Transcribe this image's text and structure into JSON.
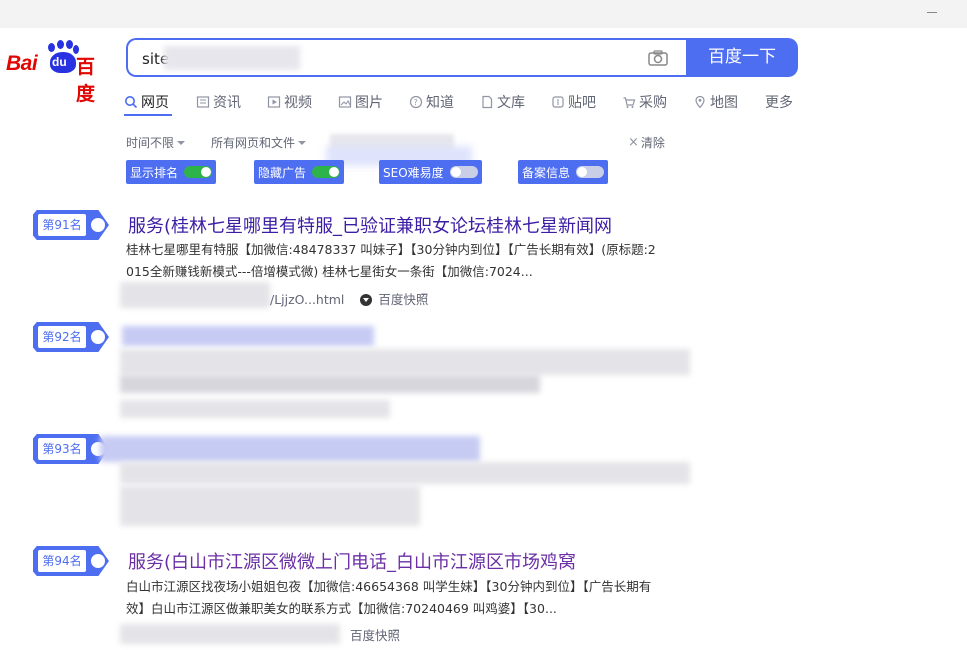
{
  "search": {
    "query_prefix": "site",
    "button_label": "百度一下"
  },
  "logo": {
    "bai": "Bai",
    "du": "du",
    "cn": "百度"
  },
  "tabs": [
    {
      "label": "网页",
      "icon": "search-icon",
      "active": true
    },
    {
      "label": "资讯",
      "icon": "news-icon"
    },
    {
      "label": "视频",
      "icon": "video-icon"
    },
    {
      "label": "图片",
      "icon": "image-icon"
    },
    {
      "label": "知道",
      "icon": "question-icon"
    },
    {
      "label": "文库",
      "icon": "document-icon"
    },
    {
      "label": "贴吧",
      "icon": "tieba-icon"
    },
    {
      "label": "采购",
      "icon": "cart-icon"
    },
    {
      "label": "地图",
      "icon": "map-icon"
    },
    {
      "label": "更多",
      "icon": ""
    }
  ],
  "filters": {
    "time": "时间不限",
    "scope": "所有网页和文件",
    "clear": "清除"
  },
  "toggles": [
    {
      "label": "显示排名",
      "on": true
    },
    {
      "label": "隐藏广告",
      "on": true
    },
    {
      "label": "SEO难易度",
      "on": false
    },
    {
      "label": "备案信息",
      "on": false
    }
  ],
  "results": [
    {
      "rank": "第91名",
      "title": "服务(桂林七星哪里有特服_已验证兼职女论坛桂林七星新闻网",
      "abstract_line1": "桂林七星哪里有特服【加微信:48478337 叫妹子】【30分钟内到位】【广告长期有效】(原标题:2",
      "abstract_line2": "015全新赚钱新模式---倍增模式微) 桂林七星街女一条街【加微信:7024...",
      "url_tail": "/LjjzO...html",
      "cache": "百度快照"
    },
    {
      "rank": "第92名"
    },
    {
      "rank": "第93名"
    },
    {
      "rank": "第94名",
      "title": "服务(白山市江源区微微上门电话_白山市江源区市场鸡窝",
      "abstract_line1": "白山市江源区找夜场小姐姐包夜【加微信:46654368 叫学生妹】【30分钟内到位】【广告长期有",
      "abstract_line2": "效】白山市江源区做兼职美女的联系方式【加微信:70240469 叫鸡婆】【30...",
      "cache": "百度快照"
    }
  ],
  "colors": {
    "accent": "#4e6ef2",
    "title": "#3c1ea5",
    "logo_red": "#e10602",
    "logo_blue": "#2932e1",
    "switch_on": "#2eb34a"
  }
}
